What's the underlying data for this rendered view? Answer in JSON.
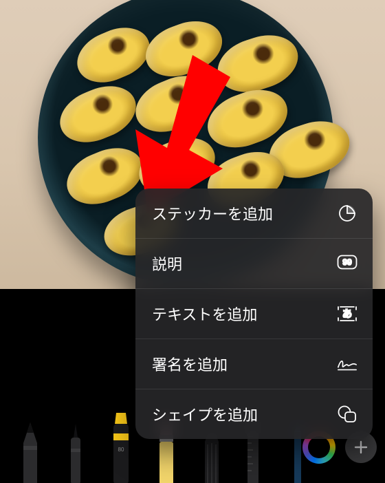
{
  "menu": {
    "items": [
      {
        "label": "ステッカーを追加",
        "icon": "sticker-icon"
      },
      {
        "label": "説明",
        "icon": "caption-icon"
      },
      {
        "label": "テキストを追加",
        "icon": "text-icon"
      },
      {
        "label": "署名を追加",
        "icon": "signature-icon"
      },
      {
        "label": "シェイプを追加",
        "icon": "shape-icon"
      }
    ]
  },
  "toolbar": {
    "tools": [
      "pen",
      "fineliner",
      "marker",
      "eraser",
      "crayon",
      "ruler",
      "pencil"
    ],
    "color_ring": "rainbow",
    "add_button": "+"
  },
  "annotation": {
    "arrow_color": "#ff0000"
  }
}
